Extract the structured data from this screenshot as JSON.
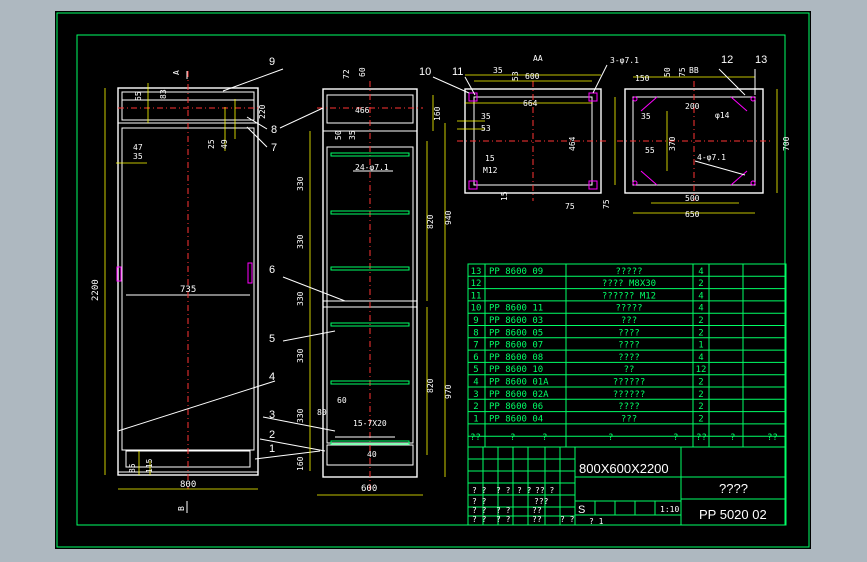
{
  "left_view": {
    "dims": {
      "height": "2200",
      "width": "800",
      "inner": "735",
      "top1": "65",
      "top2": "83",
      "top3": "220",
      "d47": "47",
      "d35": "35",
      "d25": "25",
      "d49": "49",
      "bot1": "85",
      "bot2": "115"
    },
    "section_mark_top": "A",
    "section_mark_bottom": "B",
    "callouts": [
      "9",
      "8",
      "7",
      "4",
      "3",
      "2",
      "1"
    ]
  },
  "middle_view": {
    "dims": {
      "top1": "72",
      "top2": "60",
      "w466": "466",
      "d160": "160",
      "d50": "50",
      "d35": "35",
      "hole": "24-φ7.1",
      "h330a": "330",
      "h330b": "330",
      "h330c": "330",
      "h330d": "330",
      "h330e": "330",
      "h820a": "820",
      "h940": "940",
      "h820b": "820",
      "h970": "970",
      "d80": "80",
      "d60": "60",
      "slot": "15-7X20",
      "d40": "40",
      "d160b": "160",
      "width": "600"
    },
    "callouts": [
      "6",
      "5"
    ]
  },
  "top_view_a": {
    "dims": {
      "d35": "35",
      "d53": "53",
      "d600": "600",
      "d664": "664",
      "hole": "3-φ7.1",
      "d464": "464",
      "d35b": "35",
      "d53b": "53",
      "d15": "15",
      "m12": "M12",
      "d15b": "15",
      "d75a": "75",
      "d75b": "75"
    },
    "section_label": "AA",
    "callouts": [
      "10",
      "11"
    ]
  },
  "top_view_b": {
    "dims": {
      "d150": "150",
      "d50": "50",
      "d75": "75",
      "d200": "200",
      "d35": "35",
      "d370": "370",
      "d55": "55",
      "hole": "4-φ7.1",
      "d14": "φ14",
      "d500": "500",
      "d650": "650",
      "d700": "700"
    },
    "section_label": "BB",
    "callouts": [
      "12",
      "13"
    ]
  },
  "bom": {
    "rows": [
      {
        "no": "13",
        "code": "PP 8600 09",
        "name": "?????",
        "qty": "4"
      },
      {
        "no": "12",
        "code": "",
        "name": "???? M8X30",
        "qty": "2"
      },
      {
        "no": "11",
        "code": "",
        "name": "?????? M12",
        "qty": "4"
      },
      {
        "no": "10",
        "code": "PP 8600 11",
        "name": "?????",
        "qty": "4"
      },
      {
        "no": "9",
        "code": "PP 8600 03",
        "name": "???",
        "qty": "2"
      },
      {
        "no": "8",
        "code": "PP 8600 05",
        "name": "????",
        "qty": "2"
      },
      {
        "no": "7",
        "code": "PP 8600 07",
        "name": "????",
        "qty": "1"
      },
      {
        "no": "6",
        "code": "PP 8600 08",
        "name": "????",
        "qty": "4"
      },
      {
        "no": "5",
        "code": "PP 8600 10",
        "name": "??",
        "qty": "12"
      },
      {
        "no": "4",
        "code": "PP 8600 01A",
        "name": "??????",
        "qty": "2"
      },
      {
        "no": "3",
        "code": "PP 8600 02A",
        "name": "??????",
        "qty": "2"
      },
      {
        "no": "2",
        "code": "PP 8600 06",
        "name": "????",
        "qty": "2"
      },
      {
        "no": "1",
        "code": "PP 8600 04",
        "name": "???",
        "qty": "2"
      }
    ],
    "header": {
      "no": "??",
      "code": "?",
      "code2": "?",
      "name": "?",
      "name2": "?",
      "qty": "??",
      "mat": "?",
      "note": "??"
    }
  },
  "title_block": {
    "size": "800X600X2200",
    "title": "????",
    "drawing_no": "PP 5020 02",
    "scale": "1:10",
    "stage": "S",
    "sheet": "?  1",
    "misc": [
      "? ?",
      "? ?",
      "? ?",
      "? ?",
      "?? ?",
      "? ?",
      "? ?",
      "???",
      "? ?",
      "??",
      "? ?",
      "??",
      "? ?"
    ]
  }
}
